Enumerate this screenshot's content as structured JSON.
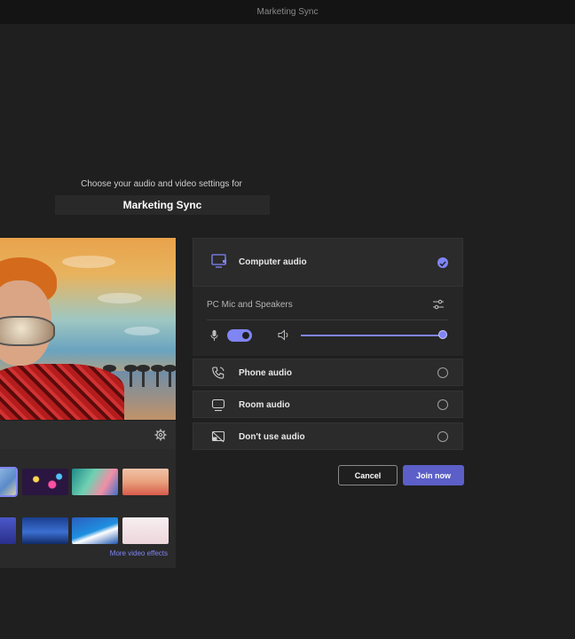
{
  "window": {
    "title": "Marketing Sync"
  },
  "prejoin": {
    "subtitle": "Choose your audio and video settings for",
    "meeting_name": "Marketing Sync"
  },
  "video": {
    "settings_icon": "gear-icon",
    "more_effects_label": "More video effects",
    "backgrounds_count_visible": 9
  },
  "audio": {
    "computer": {
      "label": "Computer audio",
      "selected": true,
      "icon": "monitor-speaker-icon"
    },
    "device": {
      "label": "PC Mic and Speakers",
      "icon": "sliders-icon"
    },
    "mic_on": true,
    "volume_level": 1.0,
    "phone": {
      "label": "Phone audio",
      "icon": "phone-icon"
    },
    "room": {
      "label": "Room audio",
      "icon": "room-display-icon"
    },
    "none": {
      "label": "Don't use audio",
      "icon": "no-audio-icon"
    }
  },
  "actions": {
    "cancel": "Cancel",
    "join": "Join now"
  },
  "colors": {
    "accent": "#7f85f5",
    "primary_button": "#5b5fc7",
    "background": "#1f1f1f"
  }
}
